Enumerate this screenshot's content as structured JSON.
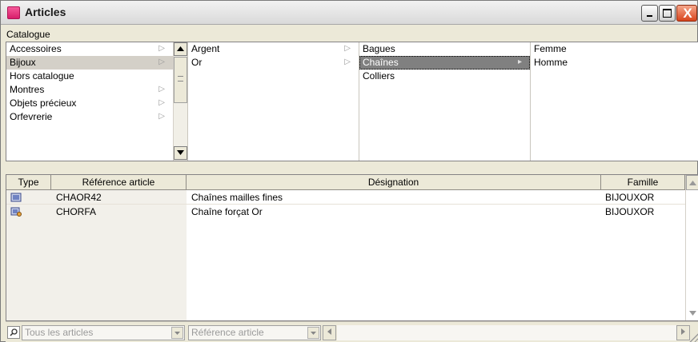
{
  "window": {
    "title": "Articles",
    "close_glyph": "X",
    "accent_color": "#e83a82"
  },
  "catalogue": {
    "label": "Catalogue",
    "column1": [
      {
        "label": "Accessoires",
        "has_children": true
      },
      {
        "label": "Bijoux",
        "has_children": true,
        "selected": true
      },
      {
        "label": "Hors catalogue",
        "has_children": false
      },
      {
        "label": "Montres",
        "has_children": true
      },
      {
        "label": "Objets précieux",
        "has_children": true
      },
      {
        "label": "Orfevrerie",
        "has_children": true
      }
    ],
    "column2": [
      {
        "label": "Argent",
        "has_children": true
      },
      {
        "label": "Or",
        "has_children": true
      }
    ],
    "column3": [
      {
        "label": "Bagues"
      },
      {
        "label": "Chaînes",
        "focused": true
      },
      {
        "label": "Colliers"
      }
    ],
    "column4": [
      {
        "label": "Femme"
      },
      {
        "label": "Homme"
      }
    ],
    "arrow_glyph": "▷",
    "arrow_glyph_focused": "▸"
  },
  "table": {
    "columns": [
      "Type",
      "Référence article",
      "Désignation",
      "Famille"
    ],
    "rows": [
      {
        "type_icon": "article-icon",
        "reference": "CHAOR42",
        "designation": "Chaînes mailles fines",
        "famille": "BIJOUXOR"
      },
      {
        "type_icon": "article-linked-icon",
        "reference": "CHORFA",
        "designation": "Chaîne forçat Or",
        "famille": "BIJOUXOR"
      }
    ]
  },
  "filters": {
    "scope_value": "Tous les articles",
    "field_value": "Référence article"
  }
}
